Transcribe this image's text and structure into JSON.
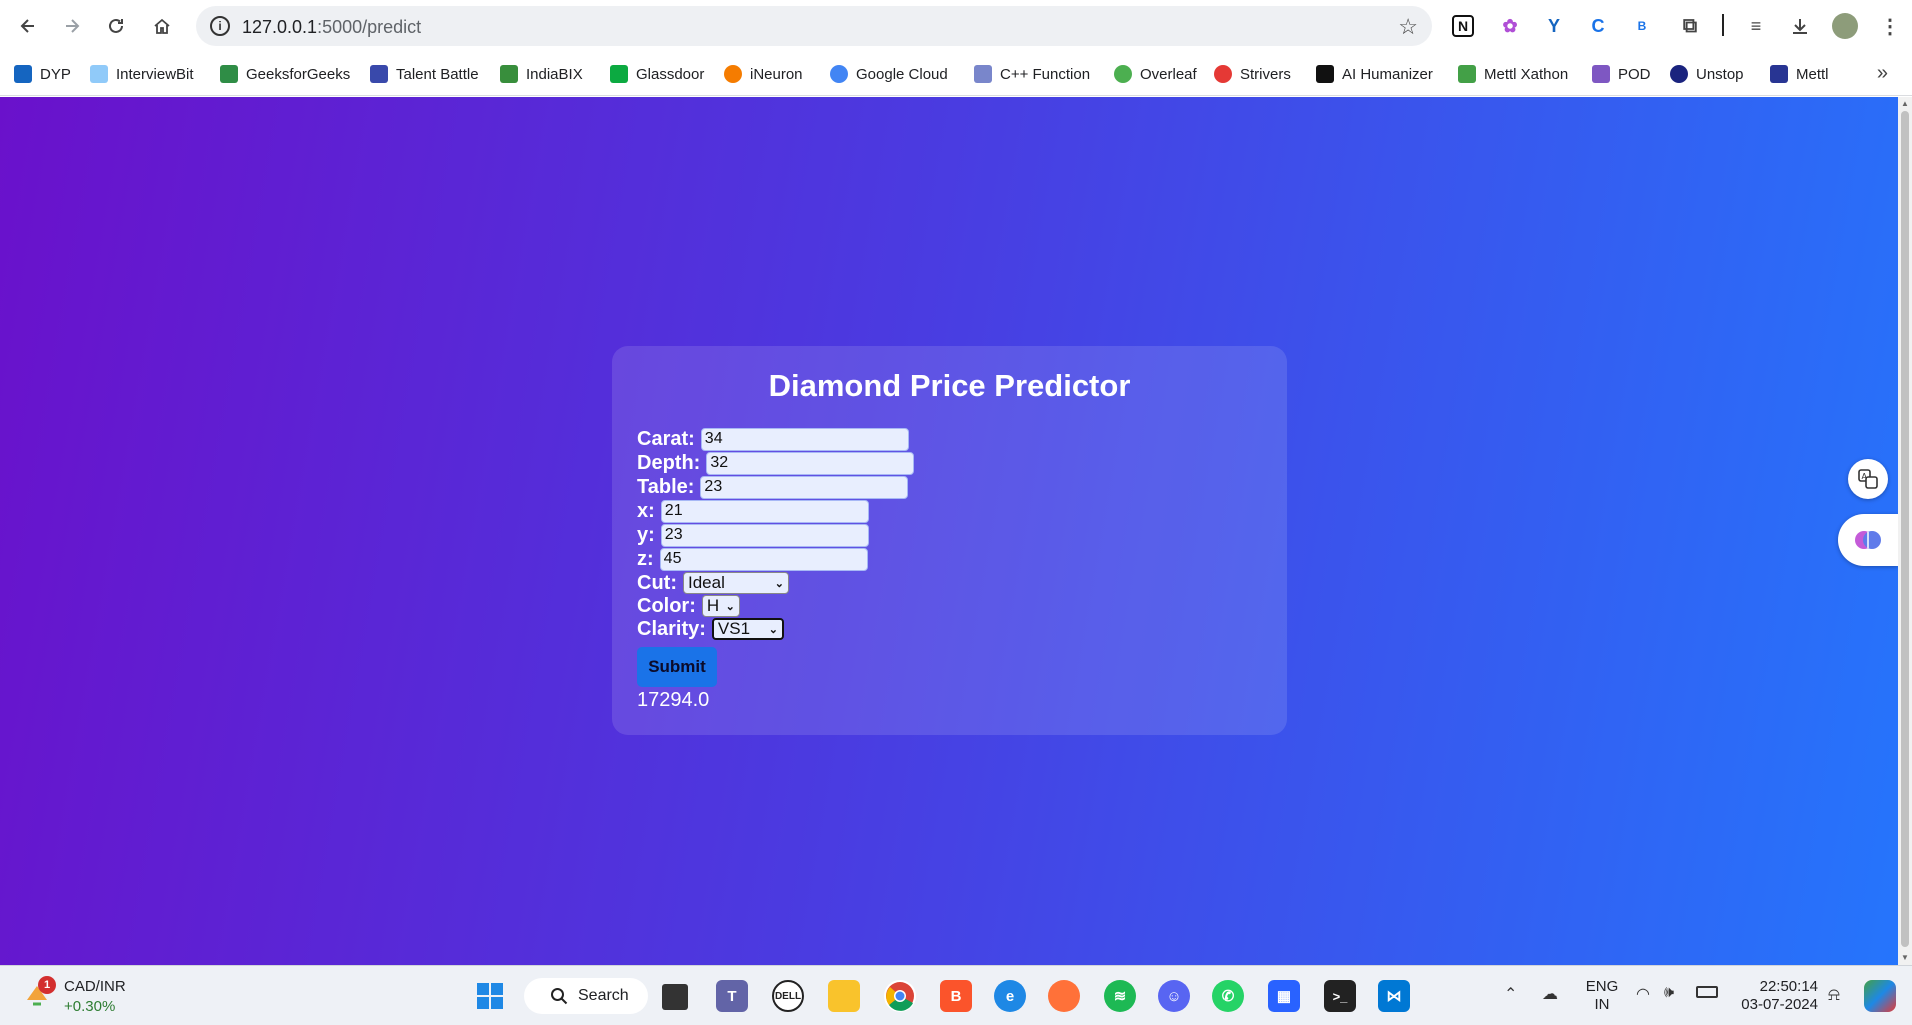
{
  "browser": {
    "url_host": "127.0.0.1",
    "url_path": ":5000/predict",
    "bookmarks": [
      "DYP",
      "InterviewBit",
      "GeeksforGeeks",
      "Talent Battle",
      "IndiaBIX",
      "Glassdoor",
      "iNeuron",
      "Google Cloud",
      "C++ Function",
      "Overleaf",
      "Strivers",
      "AI Humanizer",
      "Mettl Xathon",
      "POD",
      "Unstop",
      "Mettl"
    ]
  },
  "form": {
    "title": "Diamond Price Predictor",
    "fields": [
      {
        "label": "Carat:",
        "value": "34"
      },
      {
        "label": "Depth:",
        "value": "32"
      },
      {
        "label": "Table:",
        "value": "23"
      },
      {
        "label": "x:",
        "value": "21"
      },
      {
        "label": "y:",
        "value": "23"
      },
      {
        "label": "z:",
        "value": "45"
      }
    ],
    "selects": [
      {
        "label": "Cut:",
        "value": "Ideal"
      },
      {
        "label": "Color:",
        "value": "H"
      },
      {
        "label": "Clarity:",
        "value": "VS1"
      }
    ],
    "submit_label": "Submit",
    "result": "17294.0"
  },
  "taskbar": {
    "widget_title": "CAD/INR",
    "widget_change": "+0.30%",
    "widget_badge": "1",
    "search_label": "Search",
    "lang_top": "ENG",
    "lang_bottom": "IN",
    "time": "22:50:14",
    "date": "03-07-2024"
  },
  "colors": {
    "gradient_start": "#6a11cb",
    "gradient_end": "#2575fc",
    "submit": "#1a73e8"
  }
}
